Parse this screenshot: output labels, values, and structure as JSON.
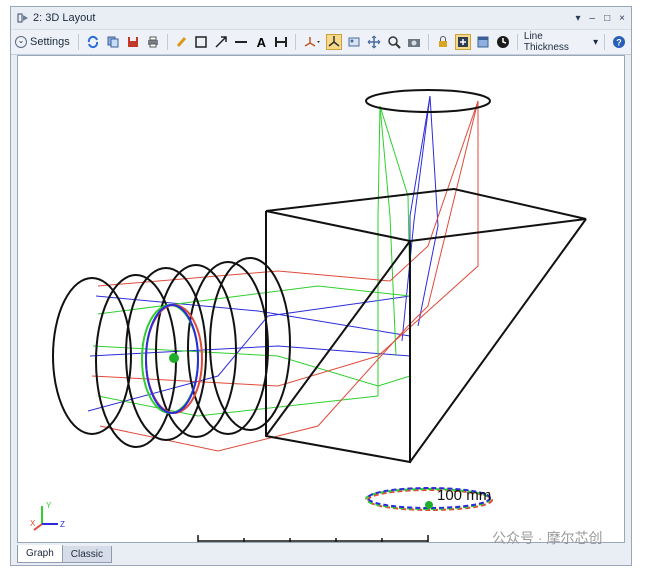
{
  "window": {
    "title": "2: 3D Layout"
  },
  "toolbar": {
    "settings_label": "Settings",
    "line_thickness_label": "Line Thickness",
    "line_thickness_arrow": "▾",
    "settings_chevron": "⌄",
    "text_tool_glyph": "A"
  },
  "window_controls": {
    "menu": "▾",
    "minimize": "–",
    "maximize": "□",
    "close": "×"
  },
  "axis_labels": {
    "x": "X",
    "y": "Y",
    "z": "Z"
  },
  "scale_bar": {
    "label": "100 mm"
  },
  "tabs": [
    {
      "label": "Graph",
      "active": true
    },
    {
      "label": "Classic",
      "active": false
    }
  ],
  "watermark": {
    "text": "公众号 · 摩尔芯创"
  },
  "colors": {
    "ray_blue": "#2b2bdd",
    "ray_green": "#2fcf2f",
    "ray_red": "#e04a3a",
    "lens": "#111111",
    "accent_active": "#f6d98a"
  }
}
